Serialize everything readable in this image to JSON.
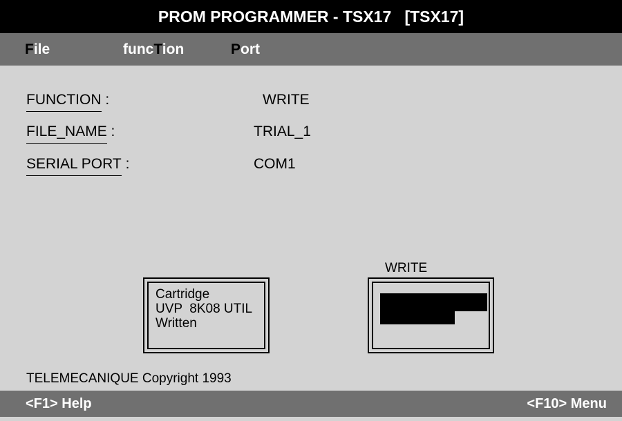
{
  "title": "PROM PROGRAMMER - TSX17   [TSX17]",
  "menu": {
    "file": {
      "hot": "F",
      "rest": "ile"
    },
    "function": {
      "pre": "func",
      "hot": "T",
      "rest": "ion"
    },
    "port": {
      "hot": "P",
      "rest": "ort"
    }
  },
  "fields": {
    "function": {
      "label": "FUNCTION",
      "value": "WRITE"
    },
    "file_name": {
      "label": "FILE_NAME",
      "value": "TRIAL_1"
    },
    "serial_port": {
      "label": "SERIAL PORT",
      "value": "COM1"
    },
    "separator": ":"
  },
  "status_box": {
    "line1": "Cartridge",
    "line2": "UVP  8K08 UTIL",
    "line3": "Written"
  },
  "write_progress": {
    "label": "WRITE"
  },
  "footer": {
    "copyright": "TELEMECANIQUE Copyright 1993",
    "help": "<F1> Help",
    "menu": "<F10> Menu"
  }
}
